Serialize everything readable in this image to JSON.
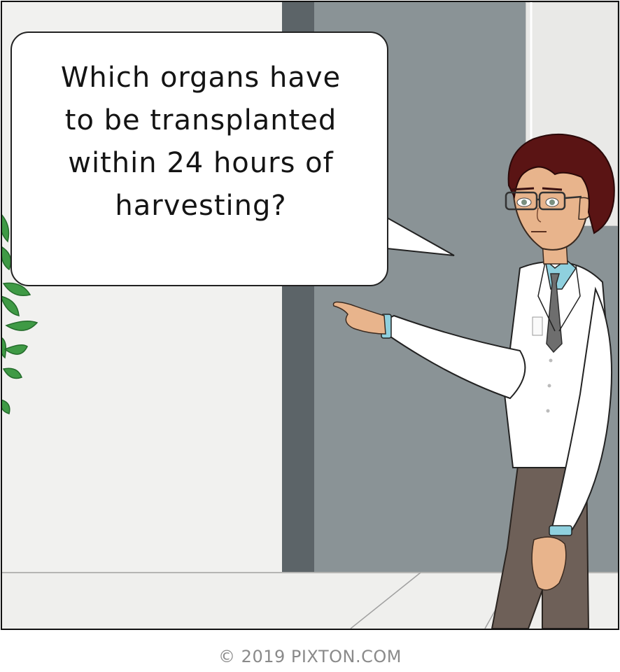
{
  "comic_panel": {
    "speech_bubble": {
      "text": "Which organs have\nto be transplanted\nwithin 24 hours of\nharvesting?"
    },
    "character": "doctor-in-lab-coat",
    "background": [
      "door",
      "plant",
      "window",
      "floor"
    ]
  },
  "footer": {
    "credit": "© 2019 PIXTON.COM"
  },
  "colors": {
    "wall": "#f1f1ef",
    "door": "#8a9396",
    "door_frame": "#5c6468",
    "plant": "#3f9a45",
    "hair": "#5a1414",
    "coat": "#ffffff",
    "tie": "#6e6e6e",
    "trousers": "#6e6058",
    "skin": "#e8b48c"
  }
}
